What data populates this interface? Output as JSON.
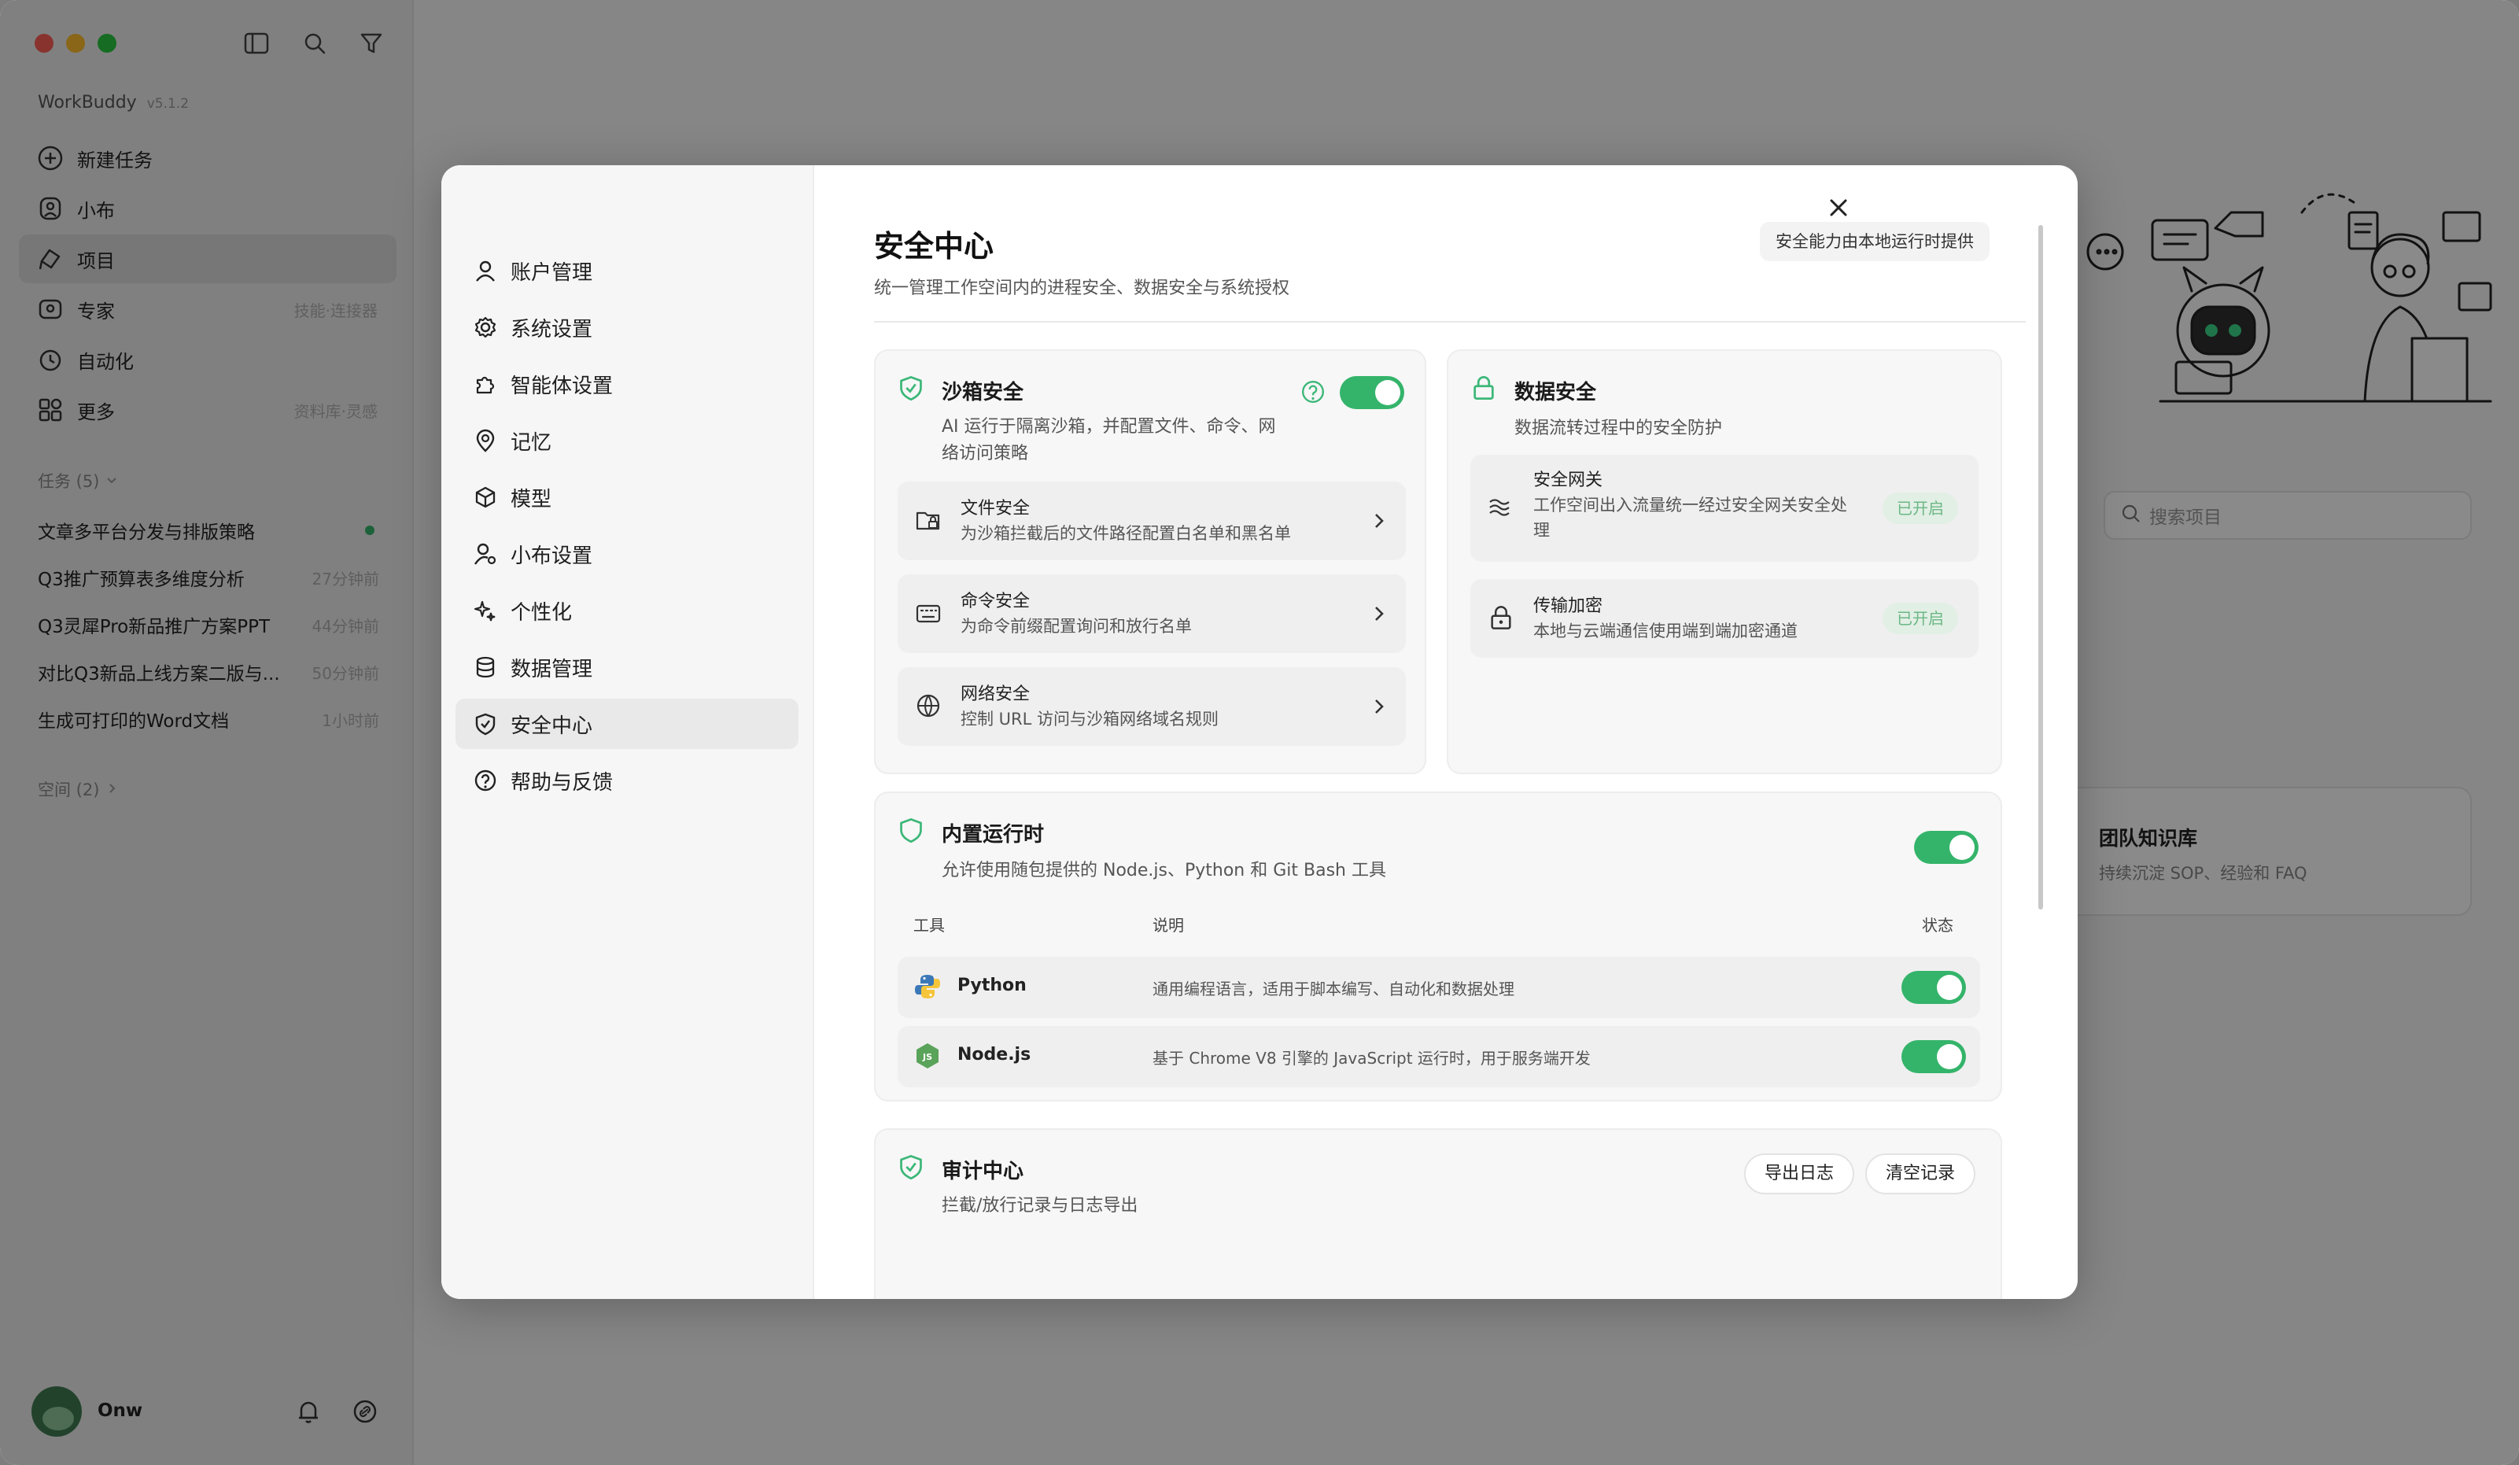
{
  "app": {
    "name": "WorkBuddy",
    "version": "v5.1.2"
  },
  "sidebar": {
    "items": [
      {
        "label": "新建任务",
        "hint": ""
      },
      {
        "label": "小布",
        "hint": ""
      },
      {
        "label": "项目",
        "hint": ""
      },
      {
        "label": "专家",
        "hint": "技能·连接器"
      },
      {
        "label": "自动化",
        "hint": ""
      },
      {
        "label": "更多",
        "hint": "资料库·灵感"
      }
    ],
    "tasks_header": "任务 (5)",
    "tasks": [
      {
        "title": "文章多平台分发与排版策略",
        "time": ""
      },
      {
        "title": "Q3推广预算表多维度分析",
        "time": "27分钟前"
      },
      {
        "title": "Q3灵犀Pro新品推广方案PPT",
        "time": "44分钟前"
      },
      {
        "title": "对比Q3新品上线方案二版与...",
        "time": "50分钟前"
      },
      {
        "title": "生成可打印的Word文档",
        "time": "1小时前"
      }
    ],
    "spaces_header": "空间 (2)",
    "user": {
      "name": "Onw"
    }
  },
  "background": {
    "search_placeholder": "搜索项目",
    "card_title": "团队知识库",
    "card_sub": "持续沉淀 SOP、经验和 FAQ"
  },
  "settings_nav": [
    {
      "label": "账户管理"
    },
    {
      "label": "系统设置"
    },
    {
      "label": "智能体设置"
    },
    {
      "label": "记忆"
    },
    {
      "label": "模型"
    },
    {
      "label": "小布设置"
    },
    {
      "label": "个性化"
    },
    {
      "label": "数据管理"
    },
    {
      "label": "安全中心"
    },
    {
      "label": "帮助与反馈"
    }
  ],
  "security": {
    "title": "安全中心",
    "subtitle": "统一管理工作空间内的进程安全、数据安全与系统授权",
    "tag": "安全能力由本地运行时提供",
    "sandbox": {
      "title": "沙箱安全",
      "desc_line1": "AI 运行于隔离沙箱，并配置文件、命令、网",
      "desc_line2": "络访问策略",
      "enabled": true,
      "items": [
        {
          "title": "文件安全",
          "desc": "为沙箱拦截后的文件路径配置白名单和黑名单"
        },
        {
          "title": "命令安全",
          "desc": "为命令前缀配置询问和放行名单"
        },
        {
          "title": "网络安全",
          "desc": "控制 URL 访问与沙箱网络域名规则"
        }
      ]
    },
    "data": {
      "title": "数据安全",
      "desc": "数据流转过程中的安全防护",
      "items": [
        {
          "title": "安全网关",
          "desc_line1": "工作空间出入流量统一经过安全网关安全处",
          "desc_line2": "理",
          "status": "已开启"
        },
        {
          "title": "传输加密",
          "desc_line1": "本地与云端通信使用端到端加密通道",
          "desc_line2": "",
          "status": "已开启"
        }
      ]
    },
    "runtime": {
      "title": "内置运行时",
      "desc": "允许使用随包提供的 Node.js、Python 和 Git Bash 工具",
      "enabled": true,
      "columns": [
        "工具",
        "说明",
        "状态"
      ],
      "tools": [
        {
          "name": "Python",
          "desc": "通用编程语言，适用于脚本编写、自动化和数据处理",
          "enabled": true
        },
        {
          "name": "Node.js",
          "desc": "基于 Chrome V8 引擎的 JavaScript 运行时，用于服务端开发",
          "enabled": true
        }
      ]
    },
    "audit": {
      "title": "审计中心",
      "desc": "拦截/放行记录与日志导出",
      "export_label": "导出日志",
      "clear_label": "清空记录"
    }
  },
  "colors": {
    "accent": "#34b46a",
    "badge_bg": "#e1efe5",
    "badge_text": "#6cb784"
  }
}
